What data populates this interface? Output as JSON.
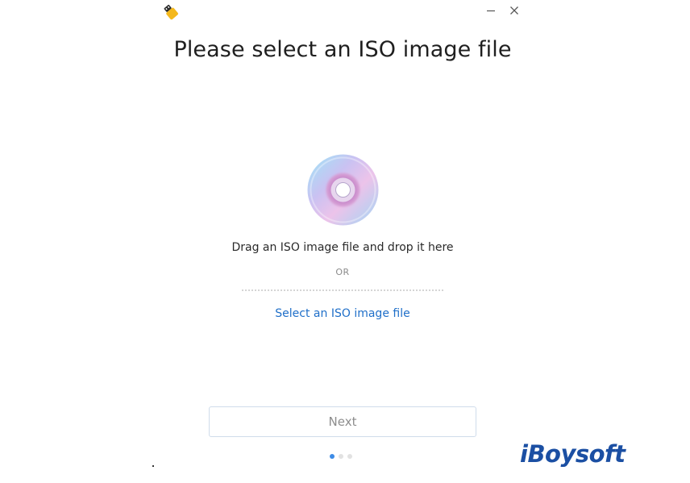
{
  "window": {
    "app_icon": "usb-drive-icon",
    "minimize_icon": "minimize-icon",
    "close_icon": "close-icon"
  },
  "main": {
    "title": "Please select an ISO image file",
    "disc_icon": "disc-icon",
    "drop_text": "Drag an ISO image file and drop it here",
    "or_text": "OR",
    "select_link": "Select an ISO image file"
  },
  "footer": {
    "next_label": "Next",
    "steps_total": 3,
    "step_active": 1
  },
  "watermark": {
    "brand": "iBoysoft"
  },
  "colors": {
    "link": "#1f6fc9",
    "active_dot": "#3d8be6",
    "brand": "#1b4fa3"
  }
}
